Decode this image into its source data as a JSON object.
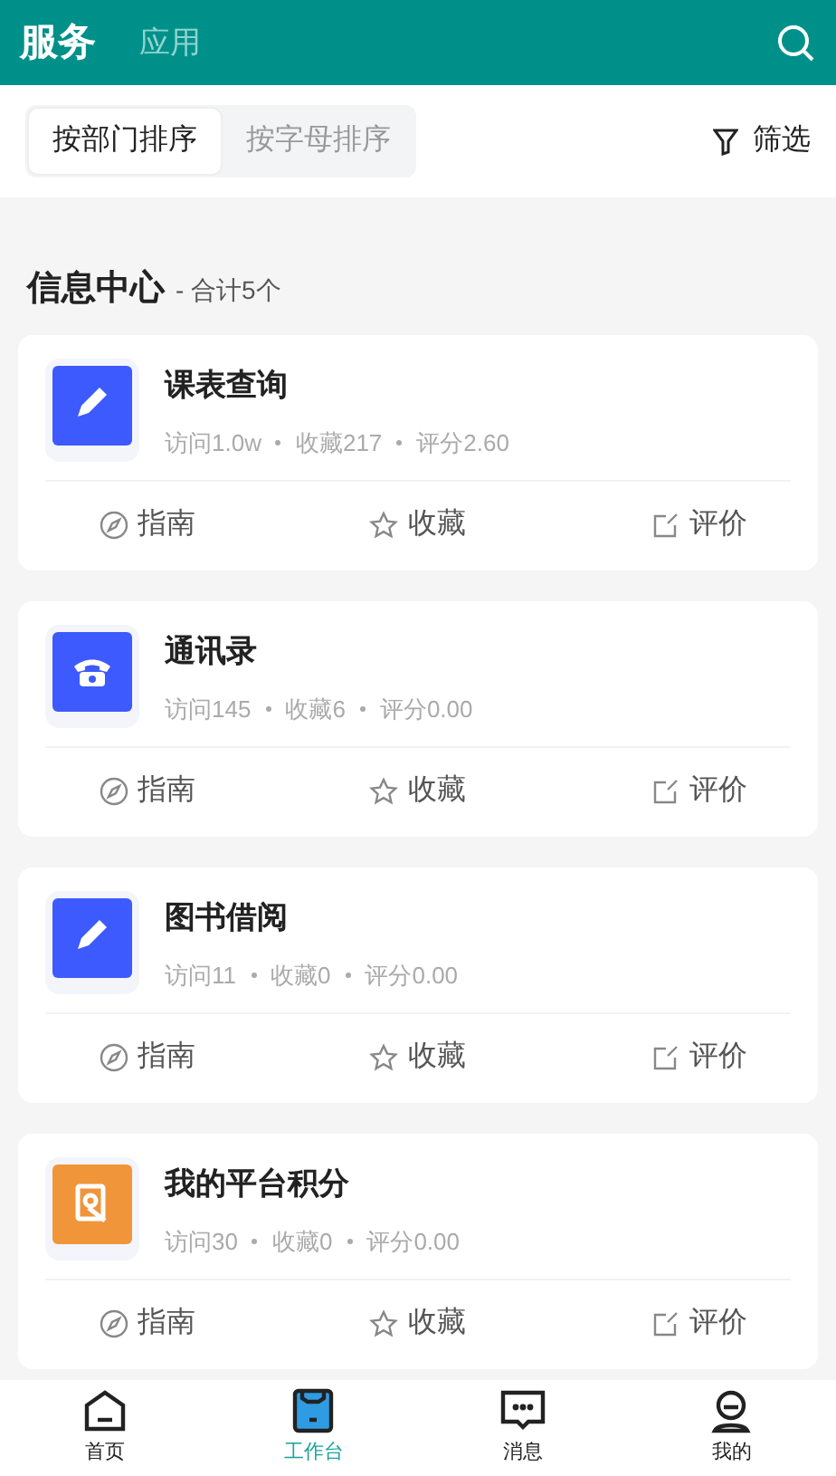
{
  "header": {
    "tabs": [
      {
        "label": "服务",
        "selected": true
      },
      {
        "label": "应用",
        "selected": false
      }
    ]
  },
  "sort_tabs": [
    {
      "label": "按部门排序",
      "selected": true
    },
    {
      "label": "按字母排序",
      "selected": false
    }
  ],
  "filter": {
    "label": "筛选"
  },
  "section": {
    "title": "信息中心",
    "count": "- 合计5个"
  },
  "services": [
    {
      "title": "课表查询",
      "kind": "pencil",
      "color": "#3d5afe",
      "stats": [
        "访问1.0w",
        "收藏217",
        "评分2.60"
      ],
      "actions": [
        "指南",
        "收藏",
        "评价"
      ]
    },
    {
      "title": "通讯录",
      "kind": "phone",
      "color": "#3d5afe",
      "stats": [
        "访问145",
        "收藏6",
        "评分0.00"
      ],
      "actions": [
        "指南",
        "收藏",
        "评价"
      ]
    },
    {
      "title": "图书借阅",
      "kind": "pencil",
      "color": "#3d5afe",
      "stats": [
        "访问11",
        "收藏0",
        "评分0.00"
      ],
      "actions": [
        "指南",
        "收藏",
        "评价"
      ]
    },
    {
      "title": "我的平台积分",
      "kind": "badge",
      "color": "#f0953a",
      "stats": [
        "访问30",
        "收藏0",
        "评分0.00"
      ],
      "actions": [
        "指南",
        "收藏",
        "评价"
      ]
    }
  ],
  "bottom_nav": [
    {
      "label": "首页",
      "selected": false
    },
    {
      "label": "工作台",
      "selected": true
    },
    {
      "label": "消息",
      "selected": false
    },
    {
      "label": "我的",
      "selected": false
    }
  ]
}
